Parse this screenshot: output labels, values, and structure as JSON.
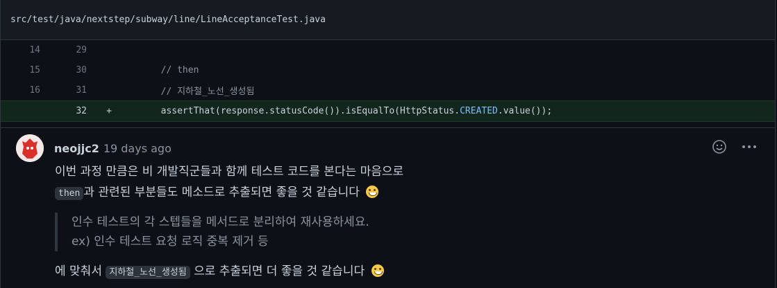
{
  "file": {
    "path": "src/test/java/nextstep/subway/line/LineAcceptanceTest.java"
  },
  "diff": {
    "lines": [
      {
        "old": "14",
        "new": "29",
        "marker": "",
        "text": ""
      },
      {
        "old": "15",
        "new": "30",
        "marker": "",
        "text": "        // then"
      },
      {
        "old": "16",
        "new": "31",
        "marker": "",
        "text": "        // 지하철_노선_생성됨"
      },
      {
        "old": "",
        "new": "32",
        "marker": "+",
        "text_prefix": "        assertThat(response.statusCode()).isEqualTo(HttpStatus.",
        "text_const": "CREATED",
        "text_suffix": ".value());"
      }
    ]
  },
  "comment": {
    "author": "neojjc2",
    "time": "19 days ago",
    "line1": "이번 과정 만큼은 비 개발직군들과 함께 테스트 코드를 본다는 마음으로",
    "code_then": "then",
    "line2_suffix": "과 관련된 부분들도 메소드로 추출되면 좋을 것 같습니다",
    "quote_line1": "인수 테스트의 각 스텝들을 메서드로 분리하여 재사용하세요.",
    "quote_line2": "ex) 인수 테스트 요청 로직 중복 제거 등",
    "line3_prefix": "에 맞춰서",
    "code_step": "지하철_노선_생성됨",
    "line3_suffix": "으로 추출되면 더 좋을 것 같습니다",
    "emoji1": "grinning-face-emoji",
    "emoji2": "grinning-face-emoji",
    "actions": {
      "emoji_reaction": "smiley-icon",
      "more": "kebab-icon"
    }
  }
}
